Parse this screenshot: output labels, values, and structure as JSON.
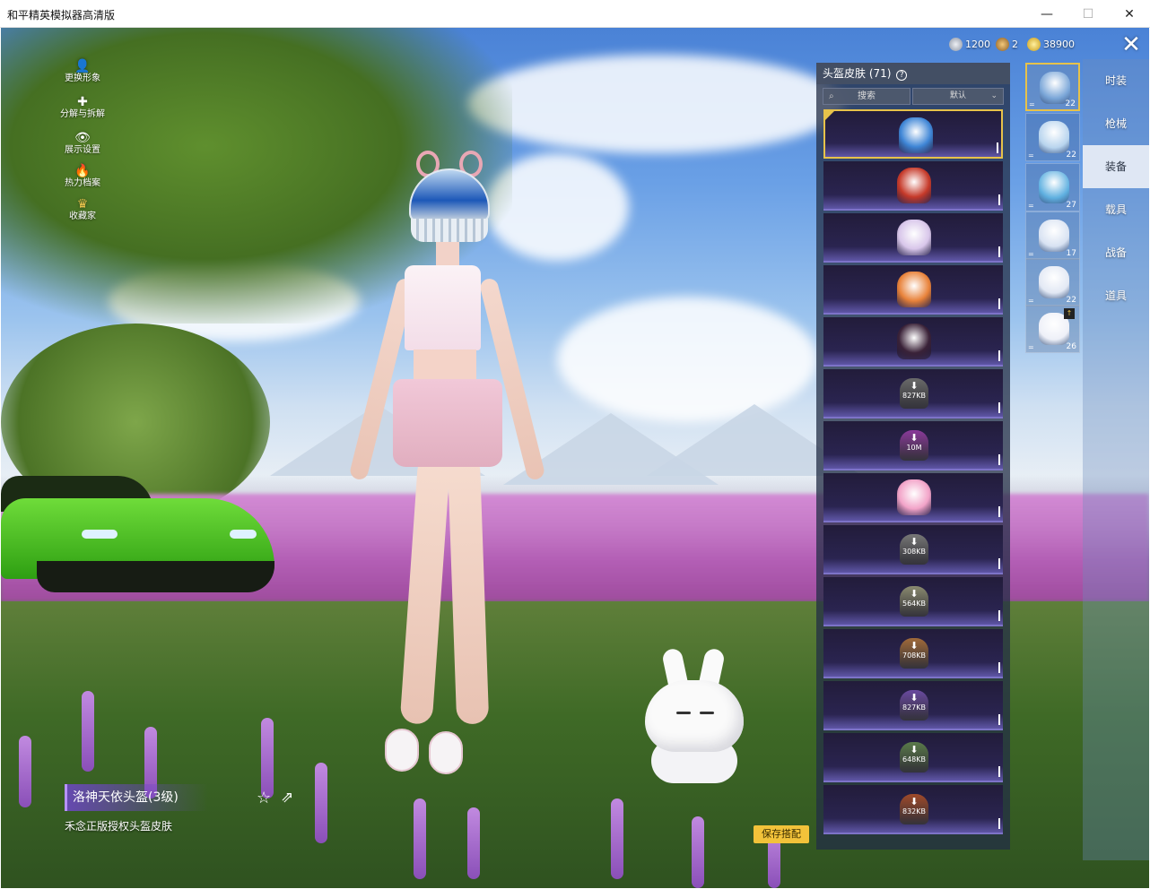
{
  "window": {
    "title": "和平精英模拟器高清版",
    "minimize": "—",
    "maximize": "☐",
    "close": "✕"
  },
  "side_menu": [
    {
      "label": "更换形象",
      "icon": "person-icon",
      "glyph": "👤"
    },
    {
      "label": "分解与拆解",
      "icon": "puzzle-icon",
      "glyph": "✚"
    },
    {
      "label": "展示设置",
      "icon": "eye-icon",
      "glyph": "👁"
    },
    {
      "label": "热力档案",
      "icon": "flame-icon",
      "glyph": "🔥"
    },
    {
      "label": "收藏家",
      "icon": "crown-badge-icon",
      "glyph": "♛"
    }
  ],
  "currency": [
    {
      "icon": "silver-coin-icon",
      "value": "1200",
      "color": "#c9ced8"
    },
    {
      "icon": "bronze-token-icon",
      "value": "2",
      "color": "#c8934a"
    },
    {
      "icon": "gold-coin-icon",
      "value": "38900",
      "color": "#e6c23a"
    }
  ],
  "close_label": "✕",
  "panel": {
    "title": "头盔皮肤 (71)",
    "help": "?",
    "search_label": "搜索",
    "sort_label": "默认",
    "skins": [
      {
        "kind": "owned",
        "color": "#3f86d6",
        "selected": true,
        "size": ""
      },
      {
        "kind": "owned",
        "color": "#c63a2a",
        "selected": false,
        "size": ""
      },
      {
        "kind": "owned",
        "color": "#d8c6ea",
        "selected": false,
        "size": ""
      },
      {
        "kind": "owned",
        "color": "#e8823a",
        "selected": false,
        "size": ""
      },
      {
        "kind": "owned",
        "color": "#3a2238",
        "selected": false,
        "size": ""
      },
      {
        "kind": "download",
        "color": "#6a6a6a",
        "selected": false,
        "size": "827KB"
      },
      {
        "kind": "download",
        "color": "#8a3a9a",
        "selected": false,
        "size": "10M"
      },
      {
        "kind": "owned",
        "color": "#f2a3c8",
        "selected": false,
        "size": ""
      },
      {
        "kind": "download",
        "color": "#777777",
        "selected": false,
        "size": "308KB"
      },
      {
        "kind": "download",
        "color": "#8a8a70",
        "selected": false,
        "size": "564KB"
      },
      {
        "kind": "download",
        "color": "#a06a3a",
        "selected": false,
        "size": "708KB"
      },
      {
        "kind": "download",
        "color": "#6a4aa0",
        "selected": false,
        "size": "827KB"
      },
      {
        "kind": "download",
        "color": "#5a7a4a",
        "selected": false,
        "size": "648KB"
      },
      {
        "kind": "download",
        "color": "#a04a2a",
        "selected": false,
        "size": "832KB"
      }
    ]
  },
  "equip_slots": [
    {
      "name": "backpack",
      "num": "22",
      "color": "#7aa6d8",
      "selected": true,
      "badge": ""
    },
    {
      "name": "helmet-cap",
      "num": "22",
      "color": "#b8d4ee",
      "selected": false,
      "badge": ""
    },
    {
      "name": "helmet",
      "num": "27",
      "color": "#5fb0e0",
      "selected": false,
      "badge": ""
    },
    {
      "name": "bunny-pack",
      "num": "17",
      "color": "#d8e2f2",
      "selected": false,
      "badge": ""
    },
    {
      "name": "bunny-pack-2",
      "num": "22",
      "color": "#e2e8f4",
      "selected": false,
      "badge": ""
    },
    {
      "name": "bunny-pack-3",
      "num": "26",
      "color": "#eef0f8",
      "selected": false,
      "badge": "↑"
    }
  ],
  "categories": [
    {
      "label": "时装",
      "active": false
    },
    {
      "label": "枪械",
      "active": false
    },
    {
      "label": "装备",
      "active": true
    },
    {
      "label": "载具",
      "active": false
    },
    {
      "label": "战备",
      "active": false
    },
    {
      "label": "道具",
      "active": false
    }
  ],
  "item": {
    "name": "洛神天依头盔(3级)",
    "desc": "禾念正版授权头盔皮肤",
    "fav_glyph": "☆",
    "share_glyph": "⇗"
  },
  "save_label": "保存搭配"
}
